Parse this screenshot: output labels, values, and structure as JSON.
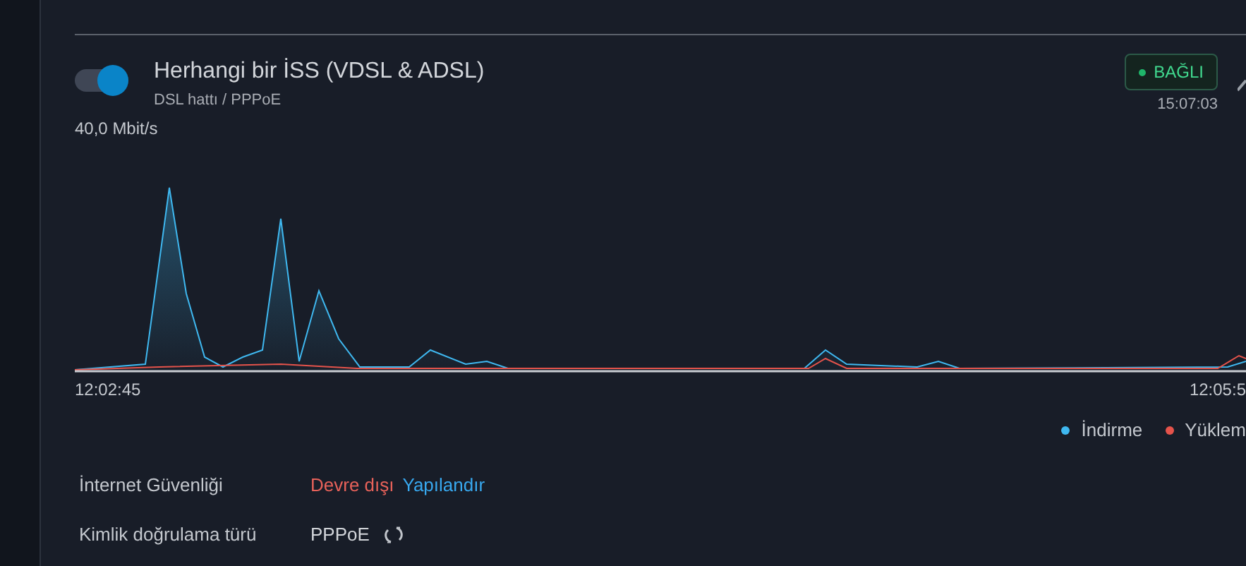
{
  "connection": {
    "enabled": true,
    "title": "Herhangi bir İSS (VDSL & ADSL)",
    "subtitle": "DSL hattı / PPPoE",
    "status": {
      "label": "BAĞLI",
      "kind": "connected"
    },
    "time": "15:07:03"
  },
  "traffic": {
    "scale_label": "40,0 Mbit/s",
    "start_time": "12:02:45",
    "end_time": "12:05:5",
    "legend": [
      {
        "label": "İndirme",
        "color": "#3fb8f0"
      },
      {
        "label": "Yüklem",
        "color": "#e5534b"
      }
    ]
  },
  "details": [
    {
      "label": "İnternet Güvenliği",
      "kind": "security",
      "value": "Devre dışı",
      "action": "Yapılandır"
    },
    {
      "label": "Kimlik doğrulama türü",
      "kind": "refresh",
      "value": "PPPoE"
    }
  ]
}
